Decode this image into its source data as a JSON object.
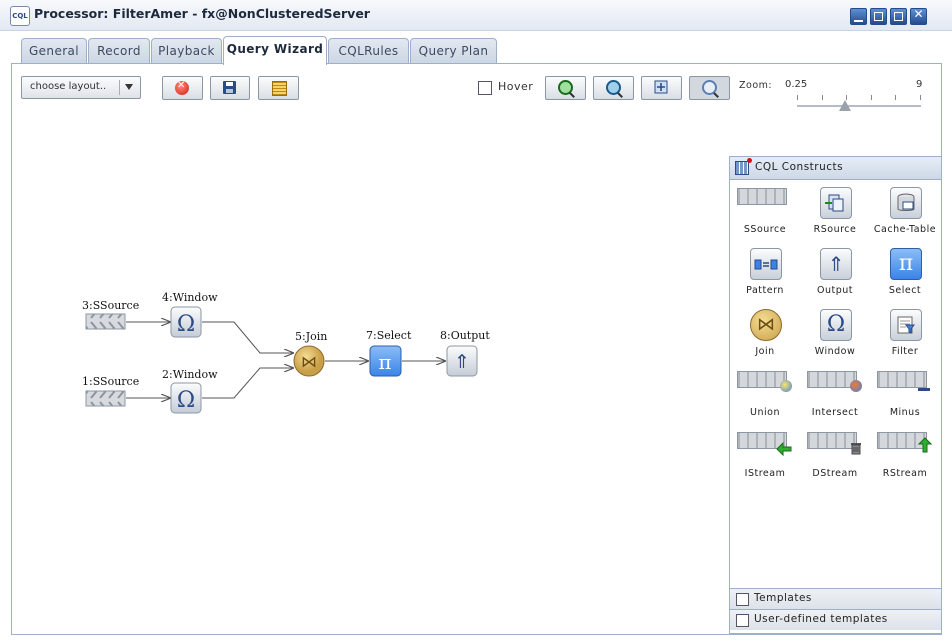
{
  "window": {
    "icon_text": "CQL",
    "title": "Processor: FilterAmer - fx@NonClusteredServer",
    "controls": [
      "minimize",
      "restore",
      "maximize",
      "close"
    ]
  },
  "tabs": [
    {
      "label": "General",
      "active": false
    },
    {
      "label": "Record",
      "active": false
    },
    {
      "label": "Playback",
      "active": false
    },
    {
      "label": "Query Wizard",
      "active": true
    },
    {
      "label": "CQLRules",
      "active": false
    },
    {
      "label": "Query Plan",
      "active": false
    }
  ],
  "toolbar": {
    "layout_select": "choose layout..",
    "hover_label": "Hover",
    "hover_checked": false,
    "zoom_label": "Zoom:",
    "zoom_min": "0.25",
    "zoom_max": "9"
  },
  "diagram": {
    "nodes": [
      {
        "id": "n3",
        "label": "3:SSource",
        "kind": "stream"
      },
      {
        "id": "n1",
        "label": "1:SSource",
        "kind": "stream"
      },
      {
        "id": "n4",
        "label": "4:Window",
        "kind": "window",
        "glyph": "Ω"
      },
      {
        "id": "n2",
        "label": "2:Window",
        "kind": "window",
        "glyph": "Ω"
      },
      {
        "id": "n5",
        "label": "5:Join",
        "kind": "join",
        "glyph": "⋈"
      },
      {
        "id": "n7",
        "label": "7:Select",
        "kind": "select",
        "glyph": "π"
      },
      {
        "id": "n8",
        "label": "8:Output",
        "kind": "output",
        "glyph": "⇑"
      }
    ],
    "edges": [
      [
        "n3",
        "n4"
      ],
      [
        "n1",
        "n2"
      ],
      [
        "n4",
        "n5"
      ],
      [
        "n2",
        "n5"
      ],
      [
        "n5",
        "n7"
      ],
      [
        "n7",
        "n8"
      ]
    ]
  },
  "cql_constructs": {
    "title": "CQL Constructs",
    "items": [
      {
        "label": "SSource",
        "icon": "stream-icon"
      },
      {
        "label": "RSource",
        "icon": "relation-source-icon"
      },
      {
        "label": "Cache-Table",
        "icon": "cache-table-icon"
      },
      {
        "label": "Pattern",
        "icon": "pattern-icon"
      },
      {
        "label": "Output",
        "icon": "output-icon",
        "glyph": "⇑"
      },
      {
        "label": "Select",
        "icon": "select-icon",
        "glyph": "π"
      },
      {
        "label": "Join",
        "icon": "join-icon",
        "glyph": "⋈"
      },
      {
        "label": "Window",
        "icon": "window-icon",
        "glyph": "Ω"
      },
      {
        "label": "Filter",
        "icon": "filter-icon"
      },
      {
        "label": "Union",
        "icon": "union-icon"
      },
      {
        "label": "Intersect",
        "icon": "intersect-icon"
      },
      {
        "label": "Minus",
        "icon": "minus-icon"
      },
      {
        "label": "IStream",
        "icon": "istream-icon"
      },
      {
        "label": "DStream",
        "icon": "dstream-icon"
      },
      {
        "label": "RStream",
        "icon": "rstream-icon"
      }
    ],
    "footer": [
      {
        "label": "Templates"
      },
      {
        "label": "User-defined templates"
      }
    ]
  }
}
